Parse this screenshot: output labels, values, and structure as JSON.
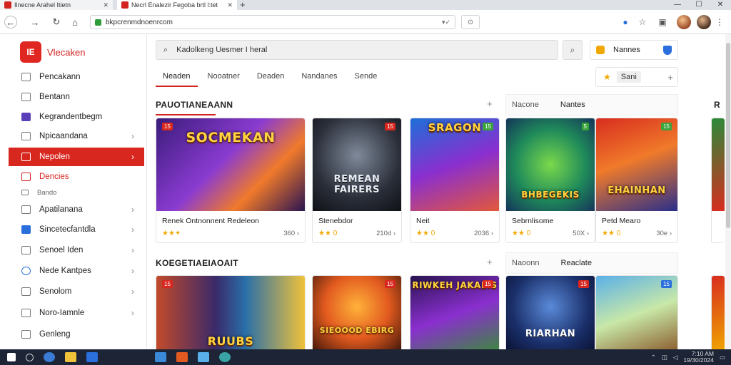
{
  "browser": {
    "tabs": [
      {
        "title": "Ilnecne Arahel Itietn"
      },
      {
        "title": "Necrl Enalezir Fegoba brtl l:tet"
      }
    ],
    "url": "bkpcrenmdnoenrcom",
    "window_controls": [
      "—",
      "☐",
      "✕"
    ]
  },
  "sidebar": {
    "logo_mark": "IE",
    "logo_name": "Vlecaken",
    "items": [
      {
        "label": "Pencakann",
        "icon": "puzzle-icon"
      },
      {
        "label": "Bentann",
        "icon": "grid-icon"
      },
      {
        "label": "Kegrandentbegm",
        "icon": "controller-icon"
      },
      {
        "label": "Npicaandana",
        "icon": "monitor-icon"
      },
      {
        "label": "Nepolen",
        "icon": "trophy-icon"
      },
      {
        "label": "Dencies",
        "icon": "gift-icon"
      },
      {
        "label": "Bando",
        "icon": "tag-icon"
      },
      {
        "label": "Apatilanana",
        "icon": "store-icon"
      },
      {
        "label": "Sincetecfantdla",
        "icon": "check-icon"
      },
      {
        "label": "Senoel Iden",
        "icon": "library-icon"
      },
      {
        "label": "Nede Kantpes",
        "icon": "compass-icon"
      },
      {
        "label": "Senolom",
        "icon": "settings-icon"
      },
      {
        "label": "Noro-Iamnle",
        "icon": "list-icon"
      },
      {
        "label": "Genleng",
        "icon": "home-icon"
      }
    ]
  },
  "header": {
    "search_value": "Kadolkeng Uesmer I heral",
    "user_label": "Nannes"
  },
  "filters": {
    "tabs": [
      "Neaden",
      "Nooatner",
      "Deaden",
      "Nandanes",
      "Sende"
    ],
    "sort_label": "Sani"
  },
  "sections": [
    {
      "heading": "PAUOTIANEAANN",
      "filter_labels": [
        "Nacone",
        "Nantes"
      ],
      "cards": [
        {
          "art_title": "SOCMEKAN",
          "name": "Renek Ontnonnent Redeleon",
          "rating": "★★✦",
          "count": "360 ›",
          "badge": "15"
        },
        {
          "art_title": "REMEAN FAIRERS",
          "name": "Stenebdor",
          "rating": "★★ 0",
          "count": "210d ›",
          "badge": "15"
        },
        {
          "art_title": "SRAGON",
          "name": "Neit",
          "rating": "★★ 0",
          "count": "2036 ›",
          "badge": "15"
        },
        {
          "art_title": "BHBEGEKIS",
          "name": "Sebrnlisome",
          "rating": "★★ 0",
          "count": "50X ›",
          "badge": "5"
        },
        {
          "art_title": "EHAINHAN",
          "name": "Petd Mearo",
          "rating": "★★ 0",
          "count": "30e ›",
          "badge": "15"
        }
      ]
    },
    {
      "heading": "KOEGETIAEIAOAIT",
      "filter_labels": [
        "Naoonn",
        "Reaclate"
      ],
      "cards": [
        {
          "art_title": "RUUBS",
          "badge": "15"
        },
        {
          "art_title": "SIEOOOD EBIRG",
          "badge": "15"
        },
        {
          "art_title": "RIWKEH JAKAEIS",
          "badge": "15"
        },
        {
          "art_title": "RIARHAN",
          "badge": "15"
        },
        {
          "art_title": "",
          "badge": "15"
        }
      ]
    }
  ],
  "edge_label": "R",
  "taskbar": {
    "time": "7:10 AM",
    "date": "19/30/2024"
  },
  "colors": {
    "accent": "#d8271f",
    "taskbar": "#1c2436"
  }
}
